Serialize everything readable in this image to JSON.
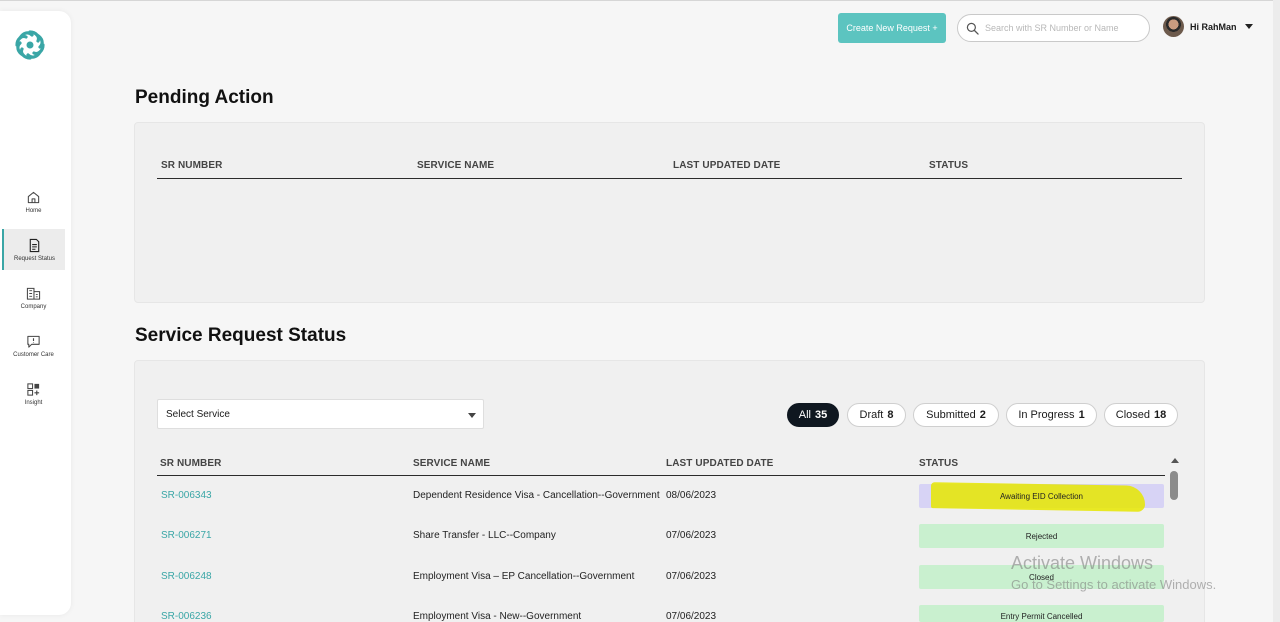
{
  "nav": {
    "items": [
      {
        "label": "Home",
        "icon": "home-icon"
      },
      {
        "label": "Request Status",
        "icon": "document-icon"
      },
      {
        "label": "Company",
        "icon": "building-icon"
      },
      {
        "label": "Customer Care",
        "icon": "message-icon"
      },
      {
        "label": "Insight",
        "icon": "insight-icon"
      }
    ]
  },
  "header": {
    "create_label": "Create New Request +",
    "search_placeholder": "Search with SR Number or Name",
    "user_greeting": "Hi RahMan"
  },
  "pending": {
    "title": "Pending Action",
    "columns": [
      "SR NUMBER",
      "SERVICE NAME",
      "LAST UPDATED DATE",
      "STATUS"
    ]
  },
  "service": {
    "title": "Service Request Status",
    "select_value": "Select Service",
    "filters": [
      {
        "label": "All",
        "count": "35"
      },
      {
        "label": "Draft",
        "count": "8"
      },
      {
        "label": "Submitted",
        "count": "2"
      },
      {
        "label": "In Progress",
        "count": "1"
      },
      {
        "label": "Closed",
        "count": "18"
      }
    ],
    "columns": [
      "SR NUMBER",
      "SERVICE NAME",
      "LAST UPDATED DATE",
      "STATUS"
    ],
    "rows": [
      {
        "sr": "SR-006343",
        "service": "Dependent Residence Visa - Cancellation--Government",
        "date": "08/06/2023",
        "status": "Awaiting EID Collection",
        "status_color": "#d7d3f5"
      },
      {
        "sr": "SR-006271",
        "service": "Share Transfer - LLC--Company",
        "date": "07/06/2023",
        "status": "Rejected",
        "status_color": "#c9f0cf"
      },
      {
        "sr": "SR-006248",
        "service": "Employment Visa – EP Cancellation--Government",
        "date": "07/06/2023",
        "status": "Closed",
        "status_color": "#c9f0cf"
      },
      {
        "sr": "SR-006236",
        "service": "Employment Visa - New--Government",
        "date": "07/06/2023",
        "status": "Entry Permit Cancelled",
        "status_color": "#c9f0cf"
      }
    ]
  },
  "watermark": {
    "line1": "Activate Windows",
    "line2": "Go to Settings to activate Windows."
  },
  "colors": {
    "accent": "#5cc4c0",
    "link": "#3aa6a6",
    "active_chip": "#0f1720",
    "highlight": "#e6e600"
  }
}
